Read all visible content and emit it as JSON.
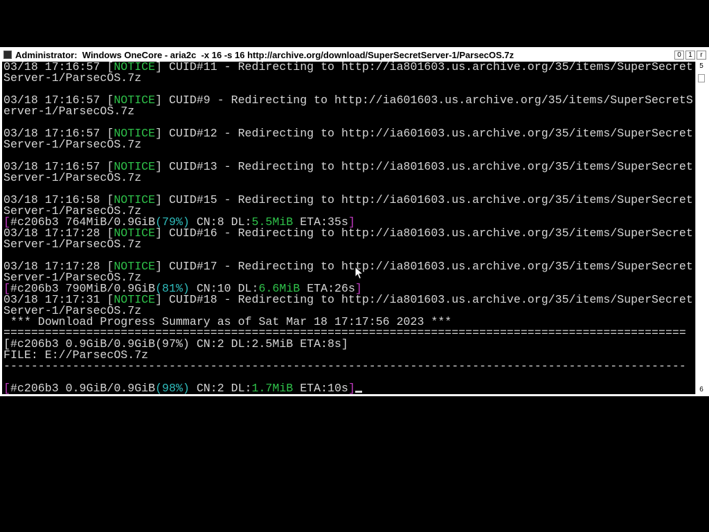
{
  "window": {
    "title": "Administrator:  Windows OneCore - aria2c  -x 16 -s 16 http://archive.org/download/SuperSecretServer-1/ParsecOS.7z",
    "controls": {
      "minimize": "0",
      "maximize": "1",
      "close": "r"
    }
  },
  "scrollbar": {
    "up": "5",
    "down": "6"
  },
  "colors": {
    "background": "#000000",
    "text": "#d6d6d6",
    "notice": "#2fc24a",
    "progress_bracket": "#c23ac2",
    "percent": "#2fbcbc",
    "speed": "#2fc24a"
  },
  "console": {
    "lines": [
      {
        "ts": "03/18 17:16:57 ",
        "tag": "NOTICE",
        "msg": "] CUID#11 - Redirecting to http://ia801603.us.archive.org/35/items/SuperSecret"
      },
      {
        "text": "Server-1/ParsecOS.7z"
      },
      {
        "text": ""
      },
      {
        "ts": "03/18 17:16:57 ",
        "tag": "NOTICE",
        "msg": "] CUID#9 - Redirecting to http://ia601603.us.archive.org/35/items/SuperSecretS"
      },
      {
        "text": "erver-1/ParsecOS.7z"
      },
      {
        "text": ""
      },
      {
        "ts": "03/18 17:16:57 ",
        "tag": "NOTICE",
        "msg": "] CUID#12 - Redirecting to http://ia601603.us.archive.org/35/items/SuperSecret"
      },
      {
        "text": "Server-1/ParsecOS.7z"
      },
      {
        "text": ""
      },
      {
        "ts": "03/18 17:16:57 ",
        "tag": "NOTICE",
        "msg": "] CUID#13 - Redirecting to http://ia801603.us.archive.org/35/items/SuperSecret"
      },
      {
        "text": "Server-1/ParsecOS.7z"
      },
      {
        "text": ""
      },
      {
        "ts": "03/18 17:16:58 ",
        "tag": "NOTICE",
        "msg": "] CUID#15 - Redirecting to http://ia601603.us.archive.org/35/items/SuperSecret"
      },
      {
        "text": "Server-1/ParsecOS.7z"
      },
      {
        "progress": {
          "id": "#c206b3 764MiB/0.9GiB",
          "pct": "(79%)",
          "cn": " CN:8 DL:",
          "dl": "5.5MiB",
          "eta": " ETA:35s",
          "close": "]"
        }
      },
      {
        "ts": "03/18 17:17:28 ",
        "tag": "NOTICE",
        "msg": "] CUID#16 - Redirecting to http://ia801603.us.archive.org/35/items/SuperSecret"
      },
      {
        "text": "Server-1/ParsecOS.7z"
      },
      {
        "text": ""
      },
      {
        "ts": "03/18 17:17:28 ",
        "tag": "NOTICE",
        "msg": "] CUID#17 - Redirecting to http://ia801603.us.archive.org/35/items/SuperSecret"
      },
      {
        "text": "Server-1/ParsecOS.7z"
      },
      {
        "progress": {
          "id": "#c206b3 790MiB/0.9GiB",
          "pct": "(81%)",
          "cn": " CN:10 DL:",
          "dl": "6.6MiB",
          "eta": " ETA:26s",
          "close": "]"
        }
      },
      {
        "ts": "03/18 17:17:31 ",
        "tag": "NOTICE",
        "msg": "] CUID#18 - Redirecting to http://ia801603.us.archive.org/35/items/SuperSecret"
      },
      {
        "text": "Server-1/ParsecOS.7z"
      },
      {
        "text": " *** Download Progress Summary as of Sat Mar 18 17:17:56 2023 ***"
      },
      {
        "text": "==================================================================================================="
      },
      {
        "text": "[#c206b3 0.9GiB/0.9GiB(97%) CN:2 DL:2.5MiB ETA:8s]"
      },
      {
        "text": "FILE: E://ParsecOS.7z"
      },
      {
        "text": "---------------------------------------------------------------------------------------------------"
      },
      {
        "text": ""
      },
      {
        "progress": {
          "id": "#c206b3 0.9GiB/0.9GiB",
          "pct": "(98%)",
          "cn": " CN:2 DL:",
          "dl": "1.7MiB",
          "eta": " ETA:10s",
          "close": "]"
        },
        "active": true
      }
    ]
  }
}
